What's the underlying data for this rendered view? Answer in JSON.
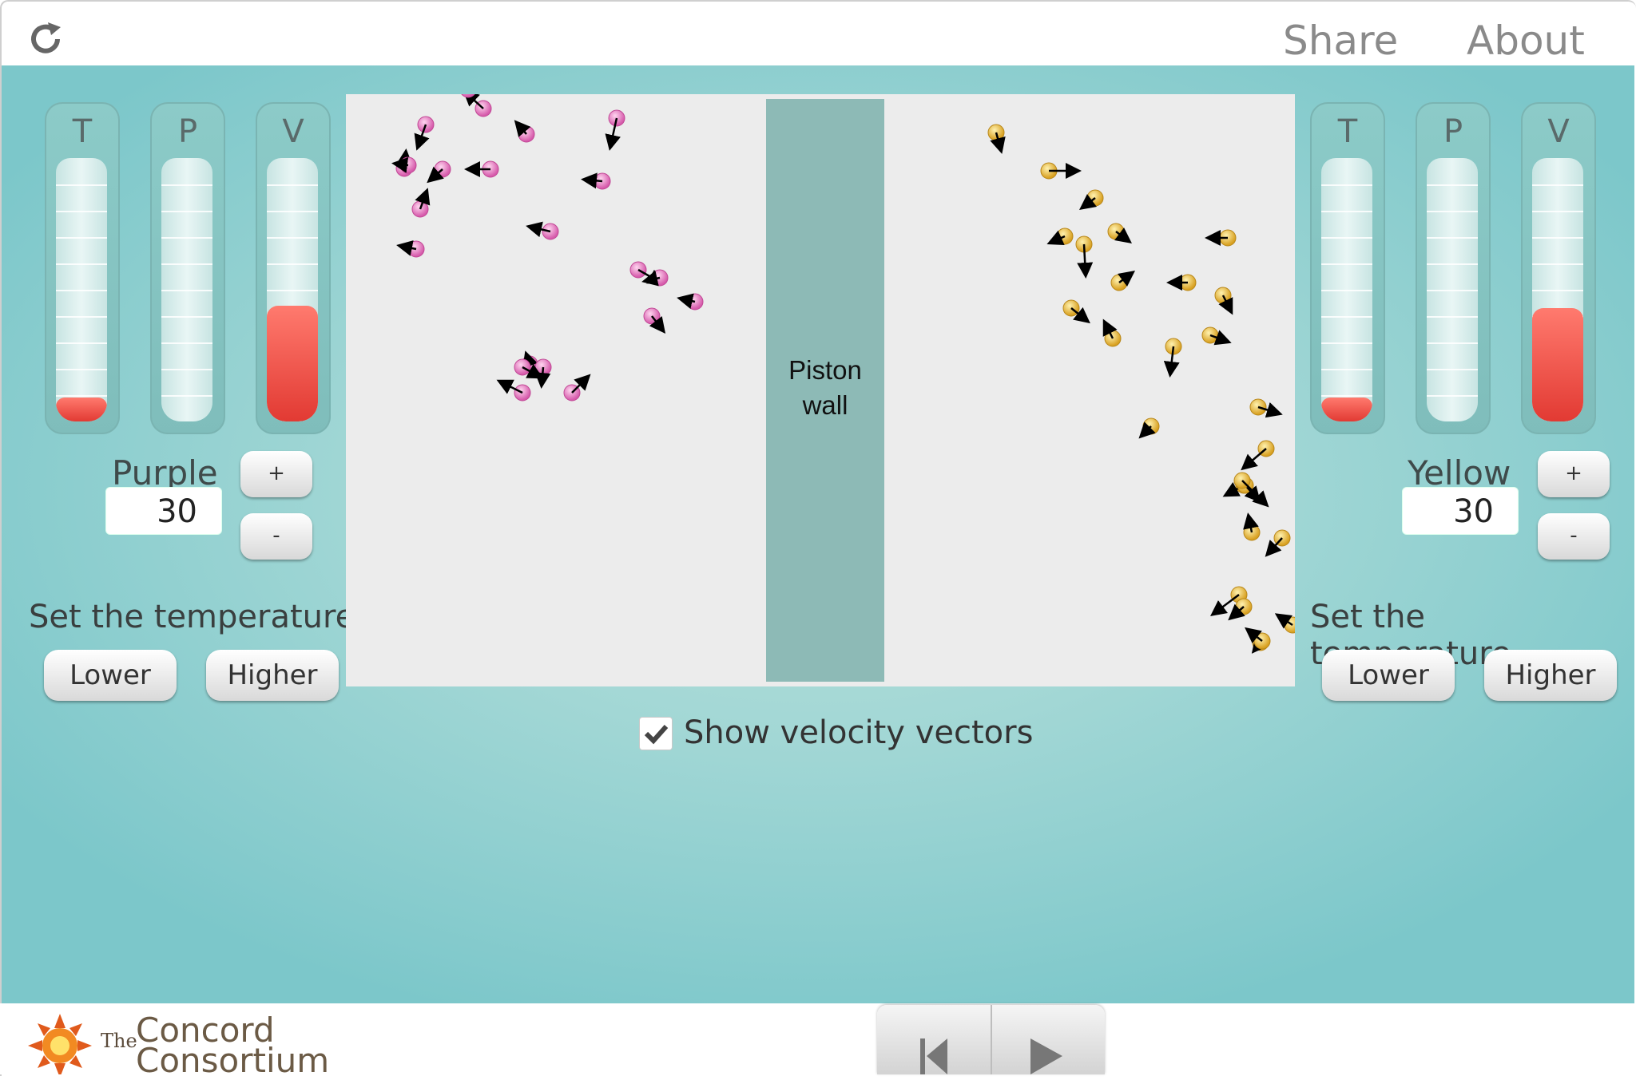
{
  "topbar": {
    "share": "Share",
    "about": "About"
  },
  "left": {
    "gauges": [
      {
        "label": "T",
        "level": 0.09
      },
      {
        "label": "P",
        "level": 0.0
      },
      {
        "label": "V",
        "level": 0.44
      }
    ],
    "species": "Purple",
    "count": "30",
    "plus": "+",
    "minus": "-",
    "set_temp": "Set the temperature",
    "lower": "Lower",
    "higher": "Higher"
  },
  "right": {
    "gauges": [
      {
        "label": "T",
        "level": 0.09
      },
      {
        "label": "P",
        "level": 0.0
      },
      {
        "label": "V",
        "level": 0.43
      }
    ],
    "species": "Yellow",
    "count": "30",
    "plus": "+",
    "minus": "-",
    "set_temp": "Set the temperature",
    "lower": "Lower",
    "higher": "Higher"
  },
  "simulation": {
    "piston_line1": "Piston",
    "piston_line2": "wall",
    "purple_color": "#e77cc0",
    "yellow_color": "#f0c040"
  },
  "velocity_vectors": {
    "label": "Show velocity vectors",
    "checked": true
  },
  "logo": {
    "the": "The",
    "name_line1": "Concord",
    "name_line2": "Consortium"
  },
  "colors": {
    "accent": "#8ccbc8",
    "gauge_fill": "#e23a33"
  }
}
